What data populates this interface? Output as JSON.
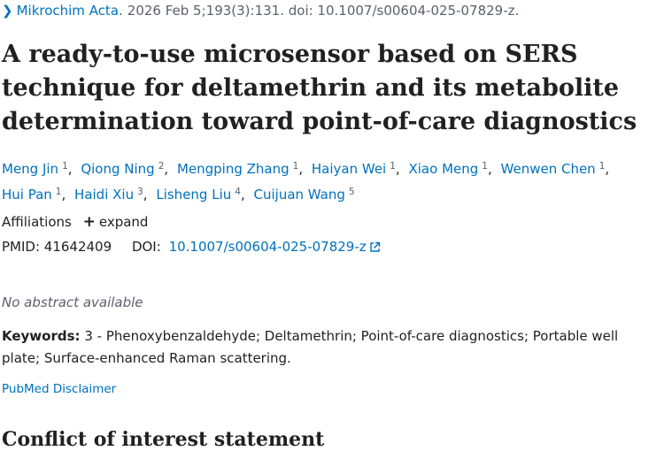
{
  "citation": {
    "journal": "Mikrochim Acta.",
    "details": "2026 Feb 5;193(3):131. doi: 10.1007/s00604-025-07829-z."
  },
  "title": "A ready-to-use microsensor based on SERS technique for deltamethrin and its metabolite determination toward point-of-care diagnostics",
  "authors": [
    {
      "name": "Meng Jin",
      "aff": "1"
    },
    {
      "name": "Qiong Ning",
      "aff": "2"
    },
    {
      "name": "Mengping Zhang",
      "aff": "1"
    },
    {
      "name": "Haiyan Wei",
      "aff": "1"
    },
    {
      "name": "Xiao Meng",
      "aff": "1"
    },
    {
      "name": "Wenwen Chen",
      "aff": "1"
    },
    {
      "name": "Hui Pan",
      "aff": "1"
    },
    {
      "name": "Haidi Xiu",
      "aff": "3"
    },
    {
      "name": "Lisheng Liu",
      "aff": "4"
    },
    {
      "name": "Cuijuan Wang",
      "aff": "5"
    }
  ],
  "affiliations": {
    "label": "Affiliations",
    "expand_label": "expand"
  },
  "ids": {
    "pmid_label": "PMID:",
    "pmid": "41642409",
    "doi_label": "DOI:",
    "doi": "10.1007/s00604-025-07829-z"
  },
  "abstract": {
    "none_text": "No abstract available"
  },
  "keywords": {
    "label": "Keywords:",
    "text": "3 - Phenoxybenzaldehyde; Deltamethrin; Point-of-care diagnostics; Portable well plate; Surface-enhanced Raman scattering."
  },
  "disclaimer": "PubMed Disclaimer",
  "next_section": "Conflict of interest statement",
  "colors": {
    "link": "#0071bc",
    "text": "#212121",
    "muted": "#5b616b"
  },
  "icons": [
    "chevron-right-icon",
    "plus-icon",
    "external-link-icon"
  ]
}
